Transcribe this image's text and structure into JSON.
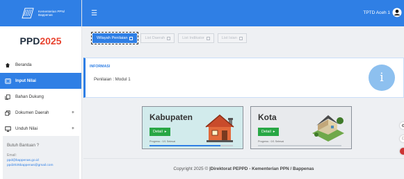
{
  "brand": {
    "org_line": "Kementerian PPN/ Bappenas",
    "logo_icon": "bappenas-logo-icon"
  },
  "app_title": {
    "part1": "PPD",
    "part2": "2025",
    "accent_color": "#e8432f"
  },
  "theme": {
    "primary": "#2f7fe5",
    "success": "#28a745"
  },
  "topbar": {
    "menu_icon": "hamburger-icon",
    "user_name": "TPTD Aceh 1",
    "user_icon": "user-avatar-icon"
  },
  "sidebar": {
    "items": [
      {
        "label": "Beranda",
        "icon": "home-icon",
        "active": false,
        "expandable": false
      },
      {
        "label": "Input Nilai",
        "icon": "tablet-icon",
        "active": true,
        "expandable": false
      },
      {
        "label": "Bahan Dukung",
        "icon": "copy-icon",
        "active": false,
        "expandable": false
      },
      {
        "label": "Dokumen Daerah",
        "icon": "clone-icon",
        "active": false,
        "expandable": true
      },
      {
        "label": "Unduh Nilai",
        "icon": "monitor-icon",
        "active": false,
        "expandable": true
      }
    ],
    "expand_symbol": "+",
    "help": {
      "title": "Butuh Bantuan ?",
      "email_label": "Email:",
      "emails": [
        "ppd@bappenas.go.id",
        "ppd2025bappenas@gmail.com"
      ]
    }
  },
  "steps": [
    {
      "label": "Wilayah Penilaian",
      "current": true
    },
    {
      "label": "List Daerah",
      "current": false
    },
    {
      "label": "List Indikator",
      "current": false
    },
    {
      "label": "List Isian",
      "current": false
    }
  ],
  "info": {
    "title": "INFORMASI",
    "label": "Penilaian",
    "value": ": Modul 1",
    "icon": "info-icon"
  },
  "cards": [
    {
      "title": "Kabupaten",
      "button": "Detail",
      "progress_text": "Progress : 0/1 Selesai",
      "progress_fraction": 0.85,
      "art_icon": "house-red-roof-icon"
    },
    {
      "title": "Kota",
      "button": "Detail",
      "progress_text": "Progress : 0/1 Selesai",
      "progress_fraction": 0,
      "art_icon": "house-isometric-icon"
    }
  ],
  "footer": {
    "prefix": "Copyright 2025 © ",
    "strong": "|Direktorat PEPPD - Kementerian PPN / Bappenas"
  }
}
